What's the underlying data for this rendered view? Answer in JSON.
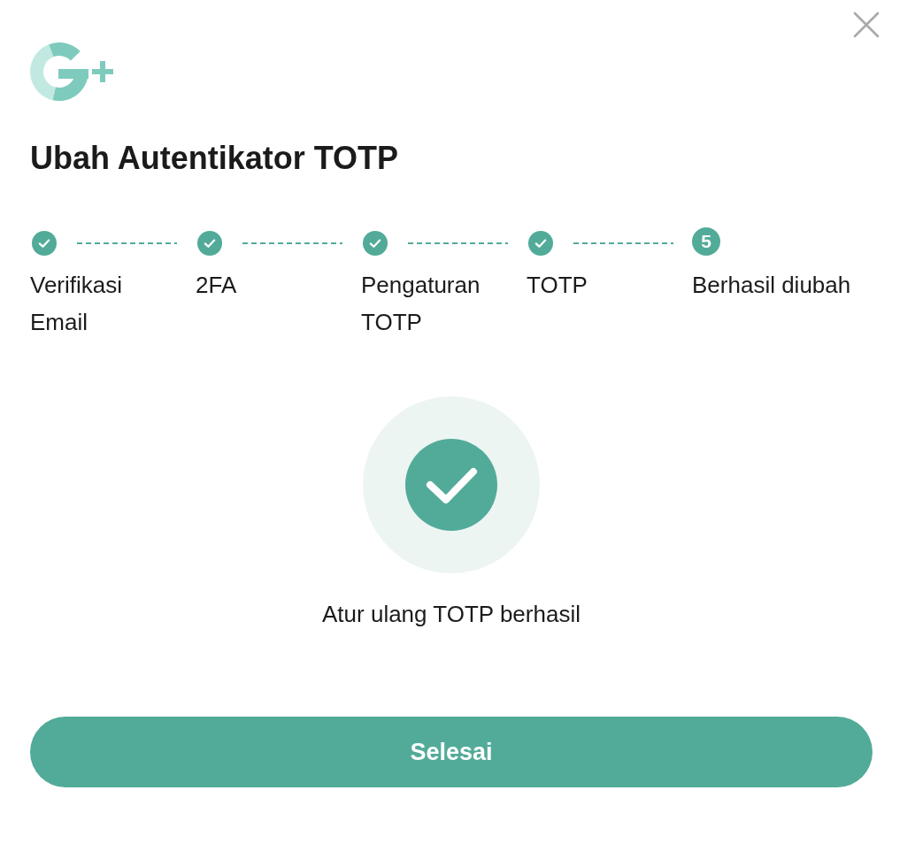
{
  "title": "Ubah Autentikator TOTP",
  "steps": [
    {
      "label": "Verifikasi Email",
      "completed": true
    },
    {
      "label": "2FA",
      "completed": true
    },
    {
      "label": "Pengaturan TOTP",
      "completed": true
    },
    {
      "label": "TOTP",
      "completed": true
    },
    {
      "label": "Berhasil diubah",
      "completed": false,
      "number": "5"
    }
  ],
  "result": {
    "message": "Atur ulang TOTP berhasil"
  },
  "primary_button": {
    "label": "Selesai"
  }
}
